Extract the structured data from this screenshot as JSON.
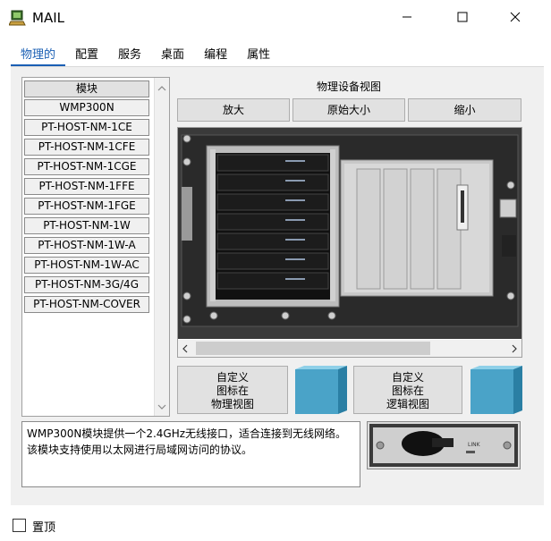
{
  "window": {
    "title": "MAIL",
    "icon": "packet-tracer-pc-icon",
    "controls": [
      "minimize-icon",
      "maximize-icon",
      "close-icon"
    ]
  },
  "tabs": [
    {
      "label": "物理的",
      "active": true
    },
    {
      "label": "配置",
      "active": false
    },
    {
      "label": "服务",
      "active": false
    },
    {
      "label": "桌面",
      "active": false
    },
    {
      "label": "编程",
      "active": false
    },
    {
      "label": "属性",
      "active": false
    }
  ],
  "modules": {
    "header": "模块",
    "items": [
      "WMP300N",
      "PT-HOST-NM-1CE",
      "PT-HOST-NM-1CFE",
      "PT-HOST-NM-1CGE",
      "PT-HOST-NM-1FFE",
      "PT-HOST-NM-1FGE",
      "PT-HOST-NM-1W",
      "PT-HOST-NM-1W-A",
      "PT-HOST-NM-1W-AC",
      "PT-HOST-NM-3G/4G",
      "PT-HOST-NM-COVER"
    ]
  },
  "physical_view": {
    "title": "物理设备视图",
    "zoom_in": "放大",
    "original_size": "原始大小",
    "zoom_out": "缩小"
  },
  "custom_icons": {
    "physical": {
      "line1": "自定义",
      "line2": "图标在",
      "line3": "物理视图"
    },
    "logical": {
      "line1": "自定义",
      "line2": "图标在",
      "line3": "逻辑视图"
    },
    "cube_color": "#4aa3c8"
  },
  "description": "WMP300N模块提供一个2.4GHz无线接口，适合连接到无线网络。该模块支持使用以太网进行局域网访问的协议。",
  "module_image": {
    "port_label": "LINK"
  },
  "footer": {
    "always_on_top": "置顶",
    "checked": false
  },
  "colors": {
    "accent": "#1a5fb4",
    "panel": "#f0f0f0",
    "button": "#e1e1e1"
  }
}
